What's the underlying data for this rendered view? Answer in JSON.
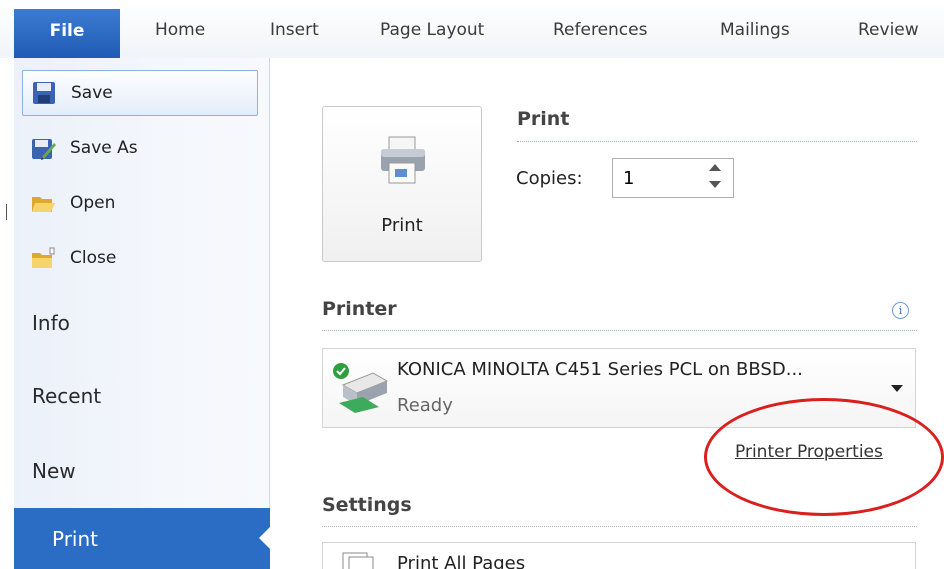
{
  "ribbon": {
    "tabs": [
      "File",
      "Home",
      "Insert",
      "Page Layout",
      "References",
      "Mailings",
      "Review"
    ]
  },
  "nav": {
    "commands": [
      {
        "label": "Save",
        "icon": "save-icon"
      },
      {
        "label": "Save As",
        "icon": "save-as-icon"
      },
      {
        "label": "Open",
        "icon": "open-folder-icon"
      },
      {
        "label": "Close",
        "icon": "close-folder-icon"
      }
    ],
    "tabs": [
      "Info",
      "Recent",
      "New"
    ],
    "selected": "Print"
  },
  "print_section": {
    "title": "Print",
    "button_label": "Print",
    "copies_label": "Copies:",
    "copies_value": "1"
  },
  "printer_section": {
    "title": "Printer",
    "printer_name": "KONICA MINOLTA C451 Series PCL on BBSD...",
    "printer_status": "Ready",
    "properties_link": "Printer Properties"
  },
  "settings_section": {
    "title": "Settings",
    "first_option": "Print All Pages"
  },
  "colors": {
    "accent": "#2b6cc4",
    "highlight_annotation": "#d9201d"
  }
}
